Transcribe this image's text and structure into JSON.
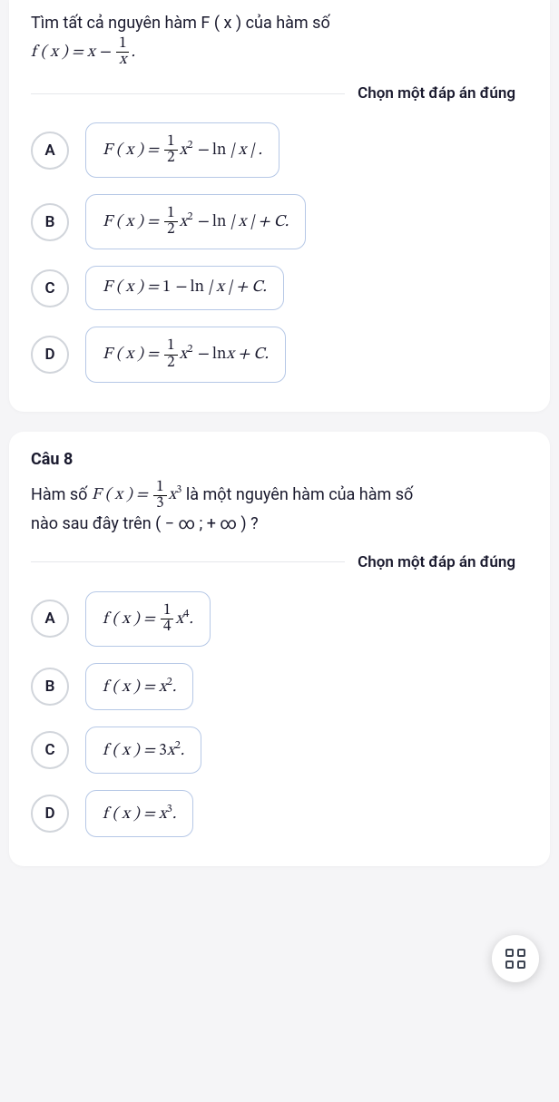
{
  "q7": {
    "question_line1": "Tìm tất cả nguyên hàm F ( x ) của hàm số",
    "instruction": "Chọn một đáp án đúng",
    "options": {
      "A": {
        "letter": "A"
      },
      "B": {
        "letter": "B"
      },
      "C": {
        "letter": "C"
      },
      "D": {
        "letter": "D"
      }
    }
  },
  "q8": {
    "label": "Câu 8",
    "question_tail": " là một nguyên hàm của hàm số",
    "question_line2": "nào sau đây trên  ( − ∞ ; + ∞ ) ?",
    "instruction": "Chọn một đáp án đúng",
    "options": {
      "A": {
        "letter": "A"
      },
      "B": {
        "letter": "B"
      },
      "C": {
        "letter": "C"
      },
      "D": {
        "letter": "D"
      }
    }
  },
  "chart_data": {
    "type": "table",
    "note": "Math expressions extracted as plain-text equivalents",
    "q7": {
      "given": "f(x) = x - 1/x",
      "choices": {
        "A": "F(x) = (1/2) x^2 - ln|x| .",
        "B": "F(x) = (1/2) x^2 - ln|x| + C.",
        "C": "F(x) = 1 - ln|x| + C.",
        "D": "F(x) = (1/2) x^2 - ln x + C."
      }
    },
    "q8": {
      "given": "F(x) = (1/3) x^3",
      "domain": "(-∞ ; +∞)",
      "choices": {
        "A": "f(x) = (1/4) x^4 .",
        "B": "f(x) = x^2 .",
        "C": "f(x) = 3 x^2 .",
        "D": "f(x) = x^3 ."
      }
    }
  }
}
